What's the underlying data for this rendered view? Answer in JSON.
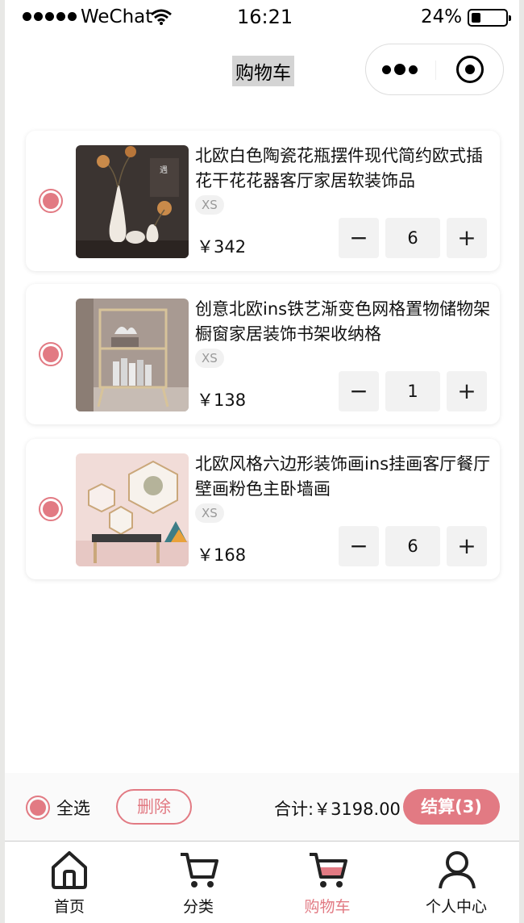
{
  "status_bar": {
    "carrier": "WeChat",
    "time": "16:21",
    "battery": "24%"
  },
  "nav": {
    "title": "购物车",
    "capsule_icons": [
      "more-icon",
      "target-icon"
    ]
  },
  "cart": {
    "items": [
      {
        "name": "北欧白色陶瓷花瓶摆件现代简约欧式插花干花花器客厅家居软装饰品",
        "size": "XS",
        "price": "￥342",
        "quantity": "6",
        "selected": true
      },
      {
        "name": "创意北欧ins铁艺渐变色网格置物储物架橱窗家居装饰书架收纳格",
        "size": "XS",
        "price": "￥138",
        "quantity": "1",
        "selected": true
      },
      {
        "name": "北欧风格六边形装饰画ins挂画客厅餐厅壁画粉色主卧墙画",
        "size": "XS",
        "price": "￥168",
        "quantity": "6",
        "selected": true
      }
    ]
  },
  "footer": {
    "select_all": "全选",
    "delete": "删除",
    "total": "合计:￥3198.00",
    "checkout": "结算(3)"
  },
  "tab_bar": {
    "tabs": [
      {
        "label": "首页",
        "icon": "home-icon"
      },
      {
        "label": "分类",
        "icon": "cart-outline-icon"
      },
      {
        "label": "购物车",
        "icon": "cart-filled-icon",
        "active": true
      },
      {
        "label": "个人中心",
        "icon": "person-icon"
      }
    ]
  },
  "colors": {
    "accent": "#e27a83",
    "stepper_bg": "#f2f2f2"
  }
}
